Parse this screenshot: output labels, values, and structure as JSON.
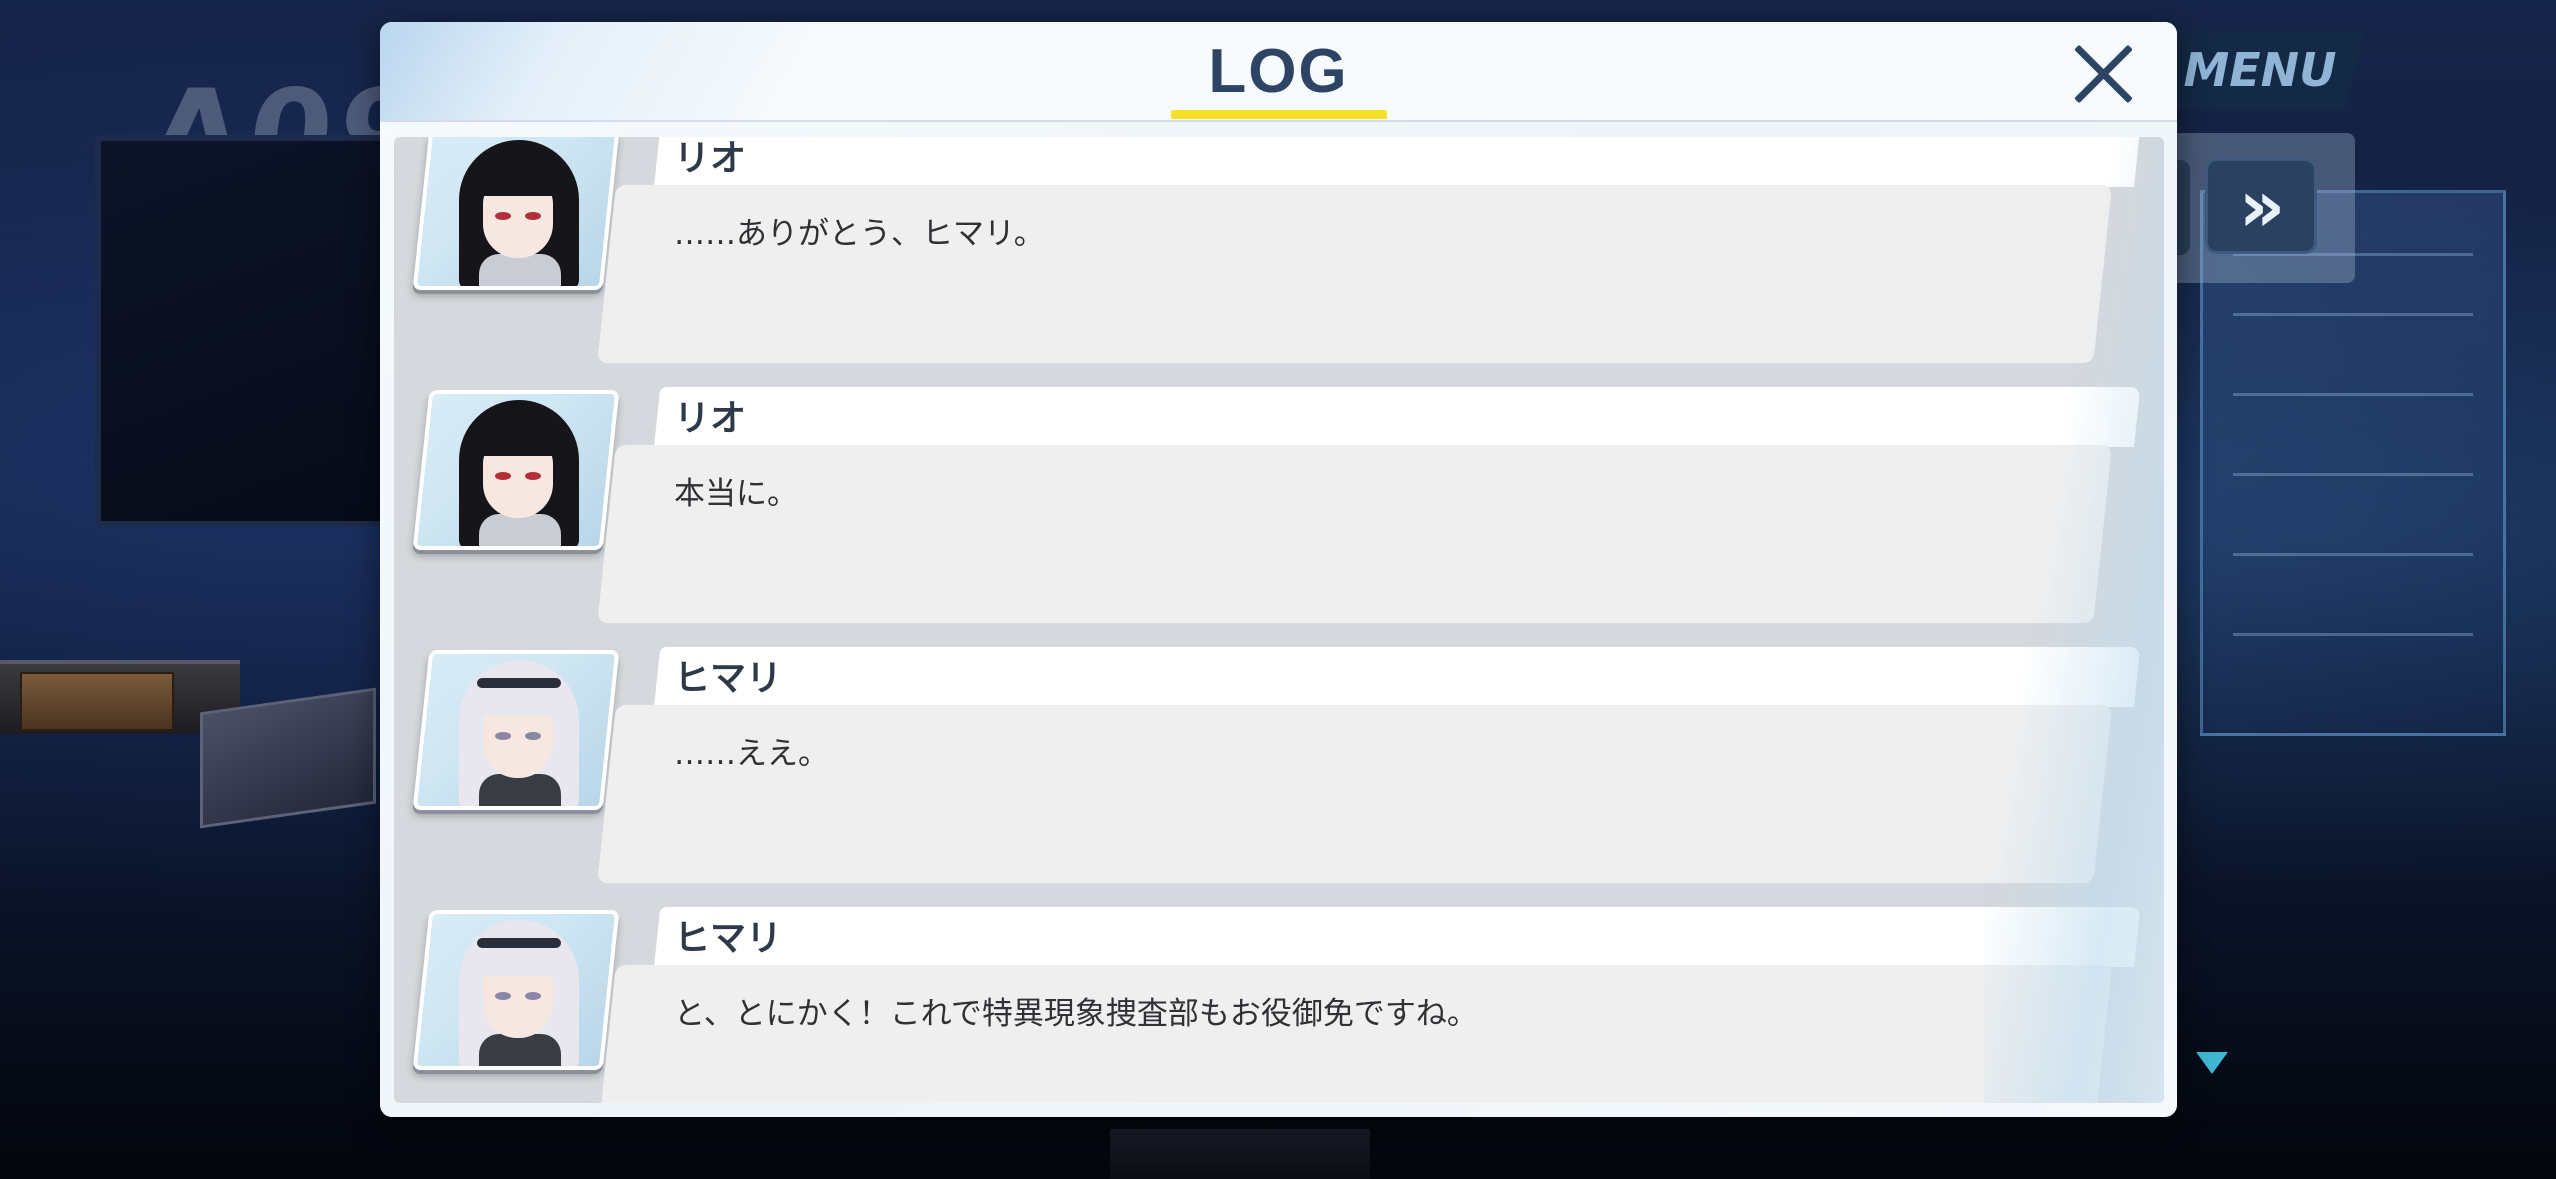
{
  "hud": {
    "menu_label": "MENU",
    "skip_label": "»"
  },
  "log": {
    "title": "LOG",
    "entries": [
      {
        "speaker": "リオ",
        "message": "……ありがとう、ヒマリ。"
      },
      {
        "speaker": "リオ",
        "message": "本当に。"
      },
      {
        "speaker": "ヒマリ",
        "message": "……ええ。"
      },
      {
        "speaker": "ヒマリ",
        "message": "と、とにかく！これで特異現象捜査部もお役御免ですね。"
      }
    ]
  },
  "colors": {
    "title_text": "#2d4465",
    "title_underline": "#f5e128",
    "panel_bg": "#f6fafd",
    "message_bg": "#efefef",
    "name_bg": "#ffffff"
  }
}
